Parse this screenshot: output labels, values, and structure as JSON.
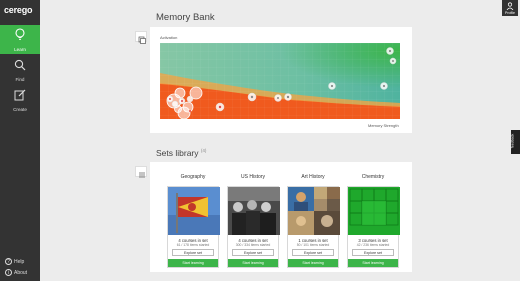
{
  "app": {
    "logo": "cerego"
  },
  "nav": {
    "learn": "Learn",
    "find": "Find",
    "create": "Create",
    "help": "Help",
    "about": "About"
  },
  "profile": {
    "label": "Profile"
  },
  "feedback": {
    "label": "feedback"
  },
  "memory_bank": {
    "title": "Memory Bank",
    "y_label": "Activation",
    "x_label": "Memory Strength"
  },
  "sets_library": {
    "title": "Sets library",
    "count": "(4)",
    "cards": [
      {
        "title": "Geography",
        "courses": "4 courses in set",
        "items": "61 / 178 items started",
        "explore": "Explore set",
        "start": "Start learning"
      },
      {
        "title": "US History",
        "courses": "4 courses in set",
        "items": "300 / 334 items started",
        "explore": "Explore set",
        "start": "Start learning"
      },
      {
        "title": "Art History",
        "courses": "1 courses in set",
        "items": "50 / 101 items started",
        "explore": "Explore set",
        "start": "Start learning"
      },
      {
        "title": "Chemistry",
        "courses": "3 courses in set",
        "items": "42 / 236 items started",
        "explore": "Explore set",
        "start": "Start learning"
      }
    ]
  },
  "colors": {
    "accent": "#3db54a",
    "sidebar": "#333333",
    "chart_teal": "#5fb9a2",
    "chart_orange": "#f0541a"
  }
}
